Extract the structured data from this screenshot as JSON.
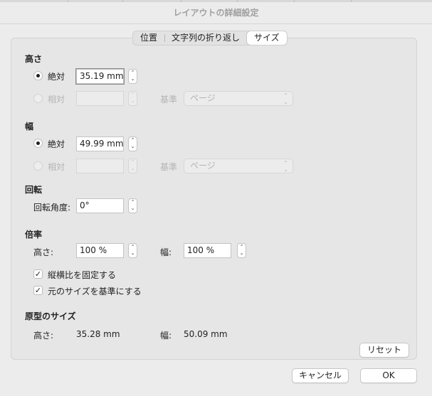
{
  "window": {
    "title": "レイアウトの詳細設定"
  },
  "tabs": [
    {
      "label": "位置",
      "active": false
    },
    {
      "label": "文字列の折り返し",
      "active": false
    },
    {
      "label": "サイズ",
      "active": true
    }
  ],
  "height_section": {
    "title": "高さ",
    "absolute_label": "絶対",
    "absolute_value": "35.19 mm",
    "relative_label": "相対",
    "relative_value": "",
    "basis_label": "基準",
    "basis_value": "ページ"
  },
  "width_section": {
    "title": "幅",
    "absolute_label": "絶対",
    "absolute_value": "49.99 mm",
    "relative_label": "相対",
    "relative_value": "",
    "basis_label": "基準",
    "basis_value": "ページ"
  },
  "rotation_section": {
    "title": "回転",
    "angle_label": "回転角度:",
    "angle_value": "0°"
  },
  "scale_section": {
    "title": "倍率",
    "height_label": "高さ:",
    "height_value": "100 %",
    "width_label": "幅:",
    "width_value": "100 %",
    "lock_aspect_label": "縦横比を固定する",
    "lock_aspect_checked": true,
    "relative_original_label": "元のサイズを基準にする",
    "relative_original_checked": true
  },
  "original_section": {
    "title": "原型のサイズ",
    "height_label": "高さ:",
    "height_value": "35.28 mm",
    "width_label": "幅:",
    "width_value": "50.09 mm"
  },
  "buttons": {
    "reset": "リセット",
    "cancel": "キャンセル",
    "ok": "OK"
  },
  "glyphs": {
    "check": "✓",
    "stepper": "⌃⌄",
    "chevron": "⌃⌄"
  }
}
